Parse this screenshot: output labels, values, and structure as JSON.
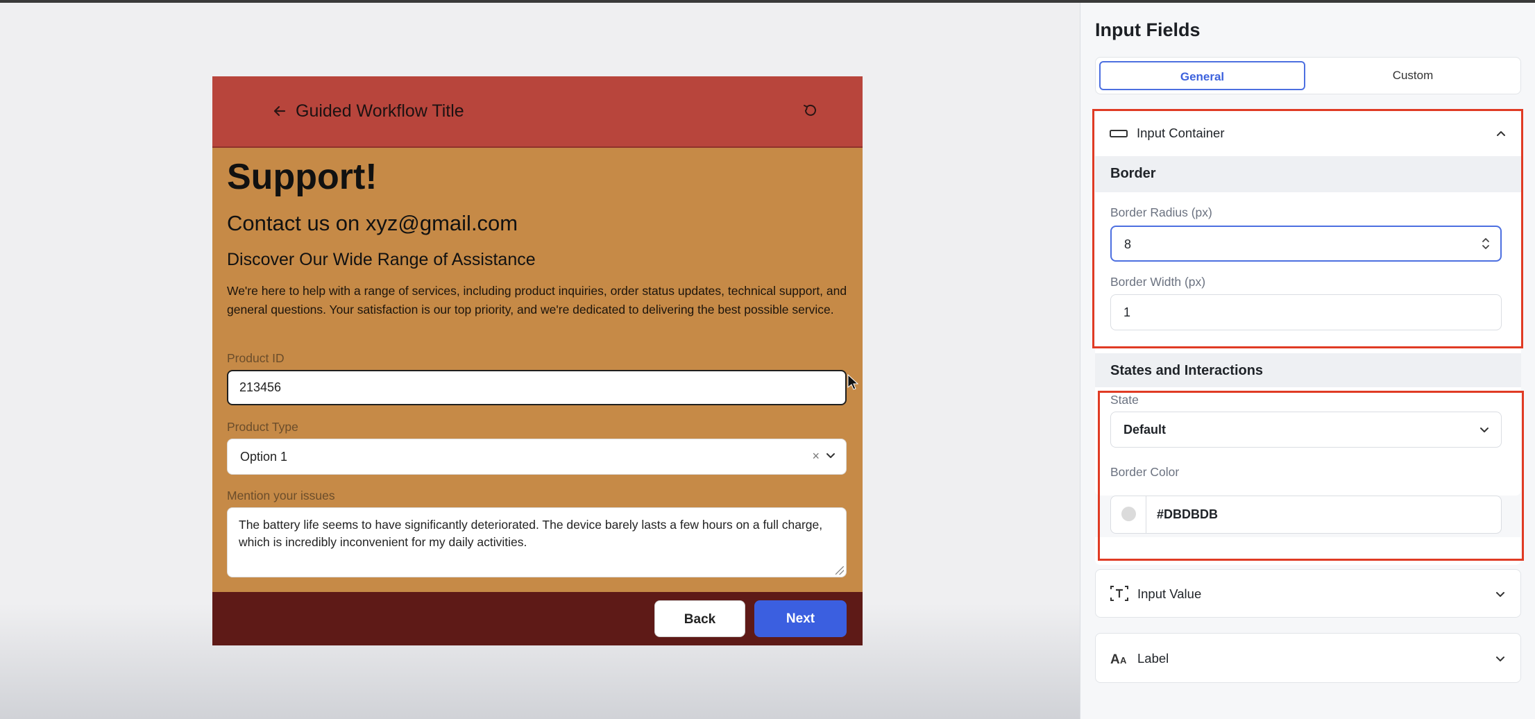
{
  "preview": {
    "header_title": "Guided Workflow Title",
    "back_icon": "arrow-left-icon",
    "refresh_icon": "refresh-icon",
    "heading1": "Support!",
    "heading2": "Contact us on xyz@gmail.com",
    "heading3": "Discover Our Wide Range of Assistance",
    "paragraph": "We're here to help with a range of services, including product inquiries, order status updates, technical support, and general questions. Your satisfaction is our top priority, and we're dedicated to delivering the best possible service.",
    "fields": {
      "product_id": {
        "label": "Product ID",
        "value": "213456"
      },
      "product_type": {
        "label": "Product Type",
        "value": "Option 1"
      },
      "issues": {
        "label": "Mention your issues",
        "value": "The battery life seems to have significantly deteriorated. The device barely lasts a few hours on a full charge, which is incredibly inconvenient for my daily activities."
      }
    },
    "buttons": {
      "back": "Back",
      "next": "Next"
    },
    "colors": {
      "header": "#b8453c",
      "body": "#c68a47",
      "footer": "#5e1a17",
      "next_button": "#3b5fe0"
    }
  },
  "panel": {
    "title": "Input Fields",
    "tabs": {
      "general": "General",
      "custom": "Custom"
    },
    "input_container": {
      "title": "Input Container",
      "border_group": "Border",
      "border_radius_label": "Border Radius (px)",
      "border_radius_value": "8",
      "border_width_label": "Border Width (px)",
      "border_width_value": "1"
    },
    "states": {
      "group": "States and Interactions",
      "state_label": "State",
      "state_value": "Default",
      "border_color_label": "Border Color",
      "border_color_value": "#DBDBDB"
    },
    "input_value": {
      "title": "Input Value"
    },
    "label_section": {
      "title": "Label"
    },
    "colors": {
      "accent": "#4c6fe0",
      "highlight": "#e03b24"
    }
  }
}
